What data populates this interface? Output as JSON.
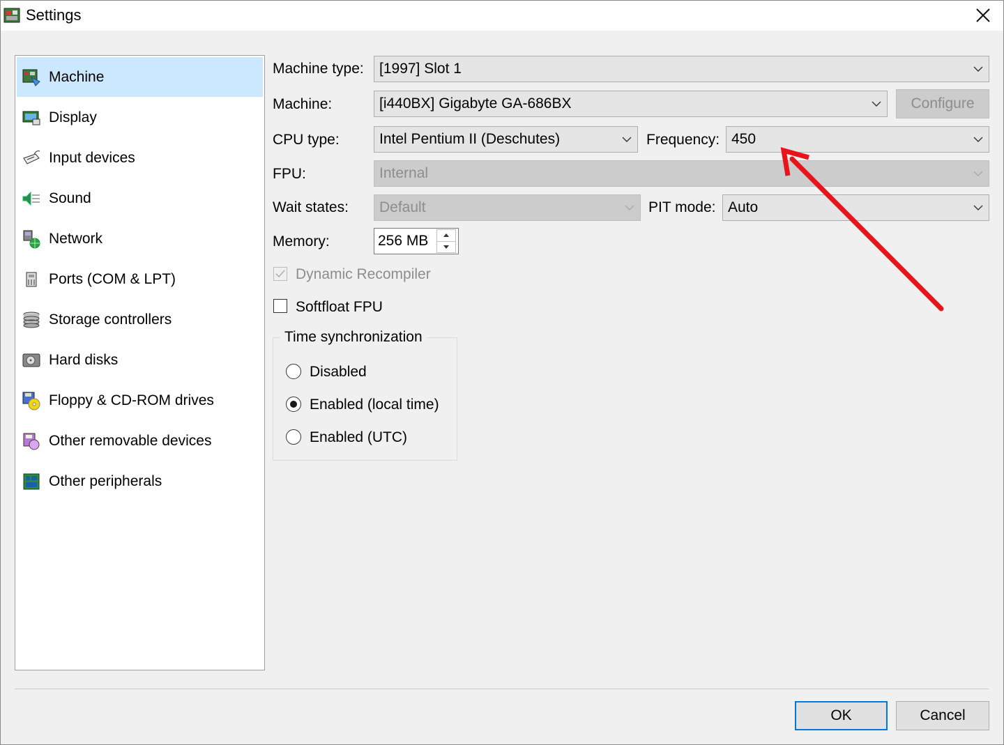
{
  "window": {
    "title": "Settings",
    "close_glyph": "✕"
  },
  "sidebar": {
    "items": [
      {
        "label": "Machine",
        "icon": "machine-icon",
        "selected": true
      },
      {
        "label": "Display",
        "icon": "display-icon"
      },
      {
        "label": "Input devices",
        "icon": "input-devices-icon"
      },
      {
        "label": "Sound",
        "icon": "sound-icon"
      },
      {
        "label": "Network",
        "icon": "network-icon"
      },
      {
        "label": "Ports (COM & LPT)",
        "icon": "ports-icon"
      },
      {
        "label": "Storage controllers",
        "icon": "storage-icon"
      },
      {
        "label": "Hard disks",
        "icon": "hard-disk-icon"
      },
      {
        "label": "Floppy & CD-ROM drives",
        "icon": "floppy-cdrom-icon"
      },
      {
        "label": "Other removable devices",
        "icon": "removable-icon"
      },
      {
        "label": "Other peripherals",
        "icon": "peripherals-icon"
      }
    ]
  },
  "machine": {
    "machine_type_label": "Machine type:",
    "machine_type_value": "[1997] Slot 1",
    "machine_label": "Machine:",
    "machine_value": "[i440BX] Gigabyte GA-686BX",
    "configure_label": "Configure",
    "cpu_type_label": "CPU type:",
    "cpu_type_value": "Intel Pentium II (Deschutes)",
    "frequency_label": "Frequency:",
    "frequency_value": "450",
    "fpu_label": "FPU:",
    "fpu_value": "Internal",
    "wait_states_label": "Wait states:",
    "wait_states_value": "Default",
    "pit_mode_label": "PIT mode:",
    "pit_mode_value": "Auto",
    "memory_label": "Memory:",
    "memory_value": "256 MB",
    "dynamic_recompiler_label": "Dynamic Recompiler",
    "dynamic_recompiler_checked": true,
    "softfloat_label": "Softfloat FPU",
    "softfloat_checked": false,
    "time_sync": {
      "title": "Time synchronization",
      "options": [
        "Disabled",
        "Enabled (local time)",
        "Enabled (UTC)"
      ],
      "selected": "Enabled (local time)"
    }
  },
  "footer": {
    "ok_label": "OK",
    "cancel_label": "Cancel"
  },
  "colors": {
    "selection": "#cce8ff",
    "accent": "#0078d7",
    "annotation_arrow": "#e8141b"
  }
}
